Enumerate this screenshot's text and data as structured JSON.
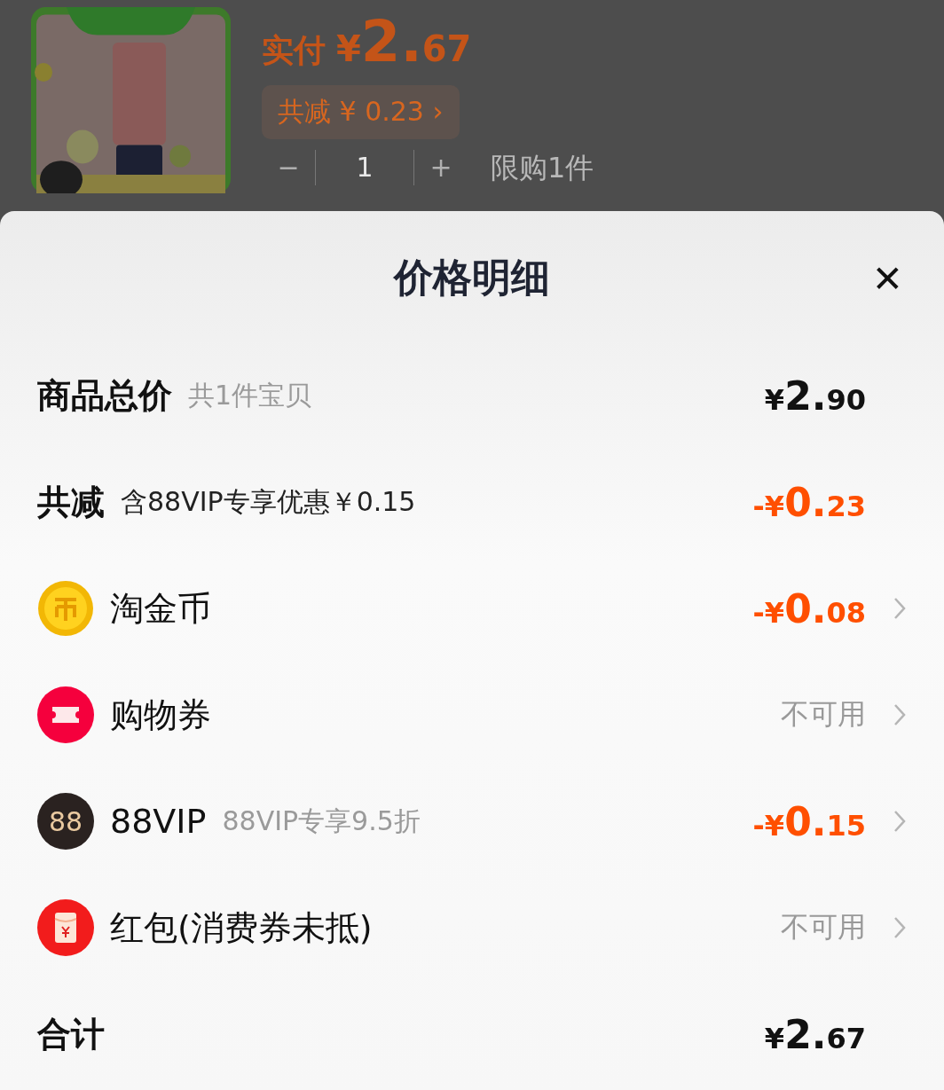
{
  "product": {
    "paid_label": "实付",
    "paid_price": "¥2.67",
    "discount_badge": "共减 ¥ 0.23 ›",
    "quantity": {
      "minus": "−",
      "value": "1",
      "plus": "+",
      "limit": "限购1件"
    }
  },
  "sheet": {
    "title": "价格明细",
    "close": "✕",
    "rows": [
      {
        "kind": "total",
        "label": "商品总价",
        "note": "共1件宝贝",
        "value": {
          "kind": "price",
          "text": "¥2.90"
        },
        "link": false
      },
      {
        "kind": "reduction",
        "label": "共减",
        "note": "含88VIP专享优惠￥0.15",
        "value": {
          "kind": "discount",
          "text": "-¥0.23"
        },
        "link": false
      },
      {
        "kind": "coin",
        "label": "淘金币",
        "value": {
          "kind": "discount",
          "text": "-¥0.08"
        },
        "link": true
      },
      {
        "kind": "coupon",
        "label": "购物券",
        "value": {
          "kind": "unavailable",
          "text": "不可用"
        },
        "link": true
      },
      {
        "kind": "vip",
        "icon_text": "88",
        "label": "88VIP",
        "note": "88VIP专享9.5折",
        "value": {
          "kind": "discount",
          "text": "-¥0.15"
        },
        "link": true
      },
      {
        "kind": "redpacket",
        "label": "红包(消费券未抵)",
        "value": {
          "kind": "unavailable",
          "text": "不可用"
        },
        "link": true
      },
      {
        "kind": "total",
        "label": "合计",
        "value": {
          "kind": "price",
          "text": "¥2.67"
        },
        "link": false
      }
    ]
  }
}
